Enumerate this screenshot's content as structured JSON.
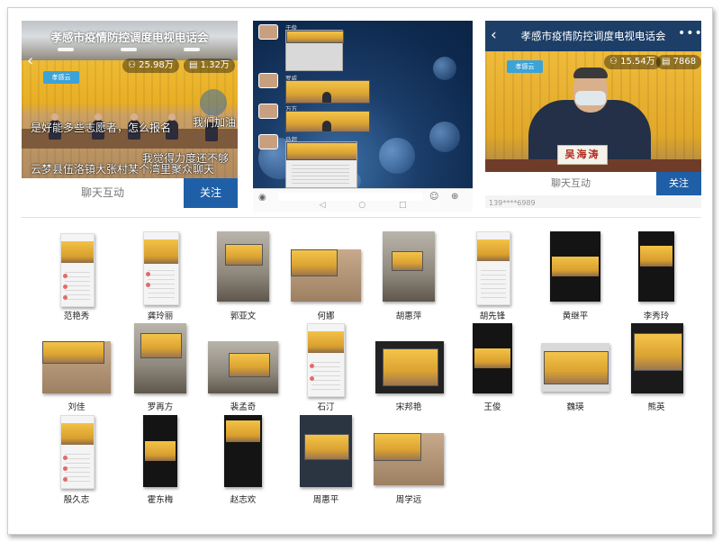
{
  "panel_live": {
    "title": "孝感市疫情防控调度电视电话会",
    "views": "25.98万",
    "comments": "1.32万",
    "logo_text": "孝感云",
    "danmu": [
      "是好能多些志愿者，怎么报名",
      "我们加油",
      "我觉得力度还不够",
      "云梦县伍洛镇大张村某个湾里聚众聊天"
    ],
    "chat_label": "聊天互动",
    "follow_label": "关注"
  },
  "panel_chat": {
    "nicks": [
      "干俊",
      "罗威",
      "万方",
      "马超"
    ]
  },
  "panel_speaker": {
    "title": "孝感市疫情防控调度电视电话会",
    "views": "15.54万",
    "comments": "7868",
    "nameplate": "吴海涛",
    "chat_label": "聊天互动",
    "follow_label": "关注",
    "masked_user": "139****6989"
  },
  "participants": [
    {
      "name": "范艳秀"
    },
    {
      "name": "龚玲丽"
    },
    {
      "name": "郭亚文"
    },
    {
      "name": "何娜"
    },
    {
      "name": "胡惠萍"
    },
    {
      "name": "胡先锋"
    },
    {
      "name": "黄继平"
    },
    {
      "name": "李秀玲"
    },
    {
      "name": "刘佳"
    },
    {
      "name": "罗再方"
    },
    {
      "name": "裴孟奇"
    },
    {
      "name": "石汀"
    },
    {
      "name": "宋邦艳"
    },
    {
      "name": "王俊"
    },
    {
      "name": "魏瑛"
    },
    {
      "name": "熊英"
    },
    {
      "name": "殷久志"
    },
    {
      "name": "霍东梅"
    },
    {
      "name": "赵志欢"
    },
    {
      "name": "周惠平"
    },
    {
      "name": "周学远"
    }
  ]
}
